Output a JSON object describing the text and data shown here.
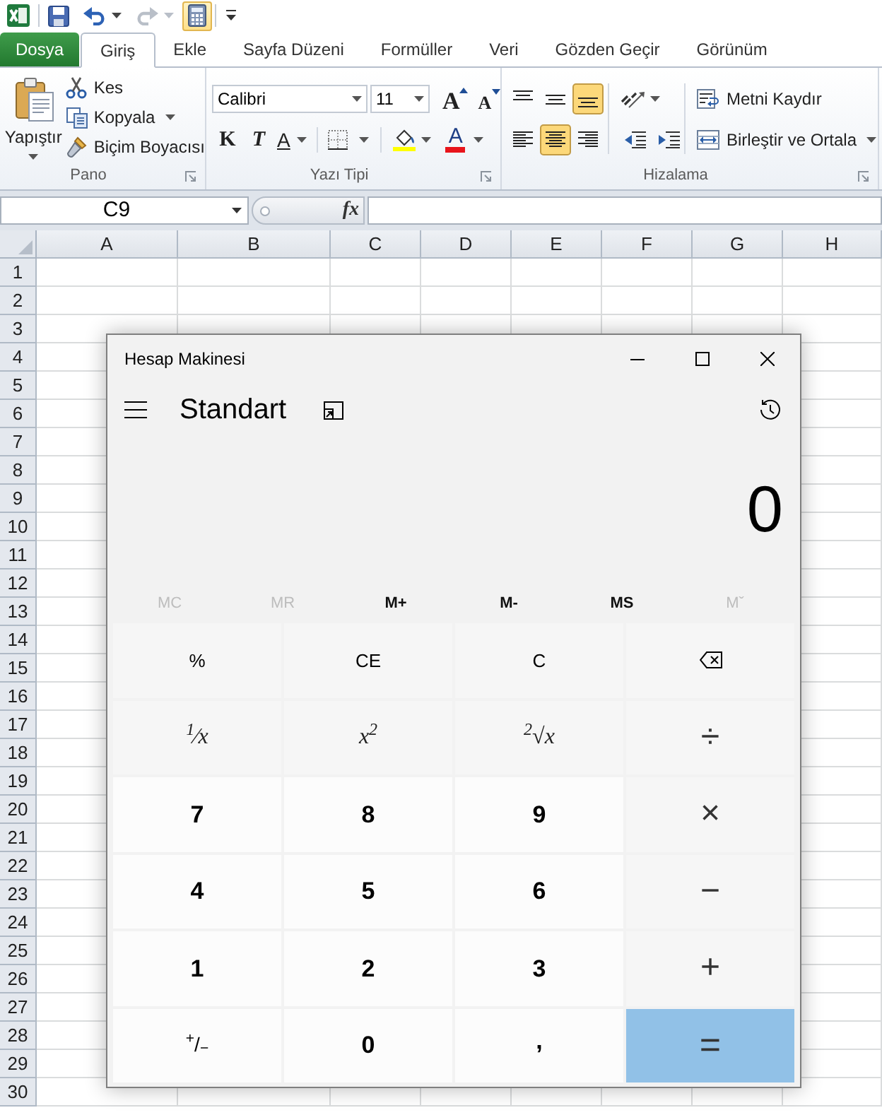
{
  "quick_access_toolbar": [
    {
      "kind": "excel",
      "highlighted": false,
      "disabled": false
    },
    {
      "kind": "save",
      "highlighted": false,
      "disabled": false
    },
    {
      "kind": "undo",
      "highlighted": false,
      "disabled": false
    },
    {
      "kind": "redo",
      "highlighted": false,
      "disabled": true
    },
    {
      "kind": "calculator",
      "highlighted": true,
      "disabled": false
    },
    {
      "kind": "customize",
      "highlighted": false,
      "disabled": false
    }
  ],
  "ribbon_tabs": [
    {
      "label": "Dosya",
      "kind": "file",
      "selected": false
    },
    {
      "label": "Giriş",
      "kind": "tab",
      "selected": true
    },
    {
      "label": "Ekle",
      "kind": "tab",
      "selected": false
    },
    {
      "label": "Sayfa Düzeni",
      "kind": "tab",
      "selected": false
    },
    {
      "label": "Formüller",
      "kind": "tab",
      "selected": false
    },
    {
      "label": "Veri",
      "kind": "tab",
      "selected": false
    },
    {
      "label": "Gözden Geçir",
      "kind": "tab",
      "selected": false
    },
    {
      "label": "Görünüm",
      "kind": "tab",
      "selected": false
    }
  ],
  "ribbon": {
    "clipboard": {
      "label": "Pano",
      "paste": "Yapıştır",
      "commands": [
        {
          "kind": "cut",
          "label": "Kes",
          "dropdown": false
        },
        {
          "kind": "copy",
          "label": "Kopyala",
          "dropdown": true
        },
        {
          "kind": "format_painter",
          "label": "Biçim Boyacısı",
          "dropdown": false
        }
      ]
    },
    "font": {
      "label": "Yazı Tipi",
      "font_name": "Calibri",
      "font_size": "11",
      "grow": "A",
      "shrink": "A",
      "bold": "K",
      "italic": "T",
      "underline": "A",
      "font_color": "A"
    },
    "alignment": {
      "label": "Hizalama",
      "vertical": [
        {
          "kind": "top",
          "selected": false
        },
        {
          "kind": "middle",
          "selected": false
        },
        {
          "kind": "bottom",
          "selected": true
        }
      ],
      "horizontal": [
        {
          "kind": "left",
          "selected": false
        },
        {
          "kind": "center",
          "selected": true
        },
        {
          "kind": "right",
          "selected": false
        }
      ],
      "wrap_text": "Metni Kaydır",
      "merge_center": "Birleştir ve Ortala"
    }
  },
  "formula_bar": {
    "name_box": "C9",
    "function_button": "fx"
  },
  "sheet": {
    "columns": [
      "A",
      "B",
      "C",
      "D",
      "E",
      "F",
      "G",
      "H"
    ],
    "rows": [
      "1",
      "2",
      "3",
      "4",
      "5",
      "6",
      "7",
      "8",
      "9",
      "10",
      "11",
      "12",
      "13",
      "14",
      "15",
      "16",
      "17",
      "18",
      "19",
      "20",
      "21",
      "22",
      "23",
      "24",
      "25",
      "26",
      "27",
      "28",
      "29",
      "30"
    ]
  },
  "calculator": {
    "title": "Hesap Makinesi",
    "mode": "Standart",
    "display": "0",
    "memory": [
      {
        "label": "MC",
        "disabled": true
      },
      {
        "label": "MR",
        "disabled": true
      },
      {
        "label": "M+",
        "disabled": false
      },
      {
        "label": "M-",
        "disabled": false
      },
      {
        "label": "MS",
        "disabled": false
      },
      {
        "label": "Mˇ",
        "disabled": true
      }
    ],
    "keys": [
      {
        "label": "%",
        "kind": "function"
      },
      {
        "label": "CE",
        "kind": "function"
      },
      {
        "label": "C",
        "kind": "function"
      },
      {
        "kind": "backspace"
      },
      {
        "label": "$^{1}$⁄x",
        "kind": "math"
      },
      {
        "label": "x$^{2}$",
        "kind": "math"
      },
      {
        "label": "$^{2}$√x",
        "kind": "math"
      },
      {
        "label": "÷",
        "kind": "operator"
      },
      {
        "label": "7",
        "kind": "digit"
      },
      {
        "label": "8",
        "kind": "digit"
      },
      {
        "label": "9",
        "kind": "digit"
      },
      {
        "label": "×",
        "kind": "operator"
      },
      {
        "label": "4",
        "kind": "digit"
      },
      {
        "label": "5",
        "kind": "digit"
      },
      {
        "label": "6",
        "kind": "digit"
      },
      {
        "label": "−",
        "kind": "operator"
      },
      {
        "label": "1",
        "kind": "digit"
      },
      {
        "label": "2",
        "kind": "digit"
      },
      {
        "label": "3",
        "kind": "digit"
      },
      {
        "label": "+",
        "kind": "operator"
      },
      {
        "label": "$^{+}$/$_{−}$",
        "kind": "sign"
      },
      {
        "label": "0",
        "kind": "digit"
      },
      {
        "label": ",",
        "kind": "decimal"
      },
      {
        "label": "=",
        "kind": "equals"
      }
    ]
  }
}
